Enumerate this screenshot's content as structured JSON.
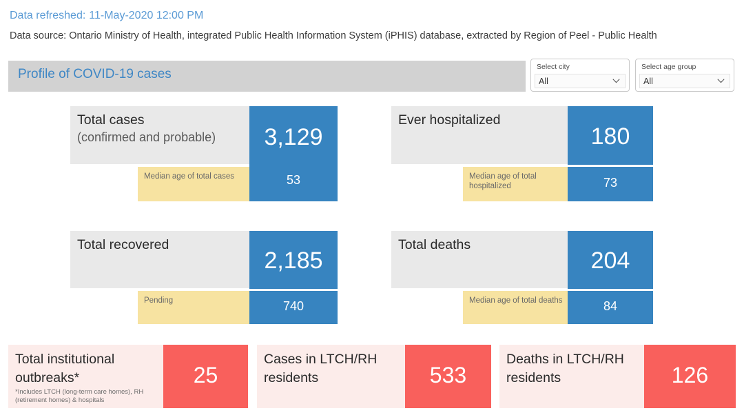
{
  "header": {
    "refresh_label": "Data refreshed:",
    "refresh_value": "11-May-2020 12:00 PM",
    "source_line": "Data source: Ontario Ministry of Health, integrated Public Health Information System (iPHIS) database, extracted by Region of Peel - Public Health",
    "title": "Profile of COVID-19 cases"
  },
  "slicers": [
    {
      "label": "Select city",
      "value": "All"
    },
    {
      "label": "Select age group",
      "value": "All"
    }
  ],
  "kpi_cards": [
    {
      "title": "Total cases",
      "subtitle": "(confirmed and probable)",
      "value": "3,129",
      "secondary_label": "Median age of total cases",
      "secondary_value": "53"
    },
    {
      "title": "Ever hospitalized",
      "subtitle": "",
      "value": "180",
      "secondary_label": "Median age of total hospitalized",
      "secondary_value": "73"
    },
    {
      "title": "Total recovered",
      "subtitle": "",
      "value": "2,185",
      "secondary_label": "Pending",
      "secondary_value": "740"
    },
    {
      "title": "Total deaths",
      "subtitle": "",
      "value": "204",
      "secondary_label": "Median age of total deaths",
      "secondary_value": "84"
    }
  ],
  "outbreak_cards": [
    {
      "title": "Total institutional outbreaks*",
      "note": "*Includes LTCH (long-term care homes), RH (retirement homes) & hospitals",
      "value": "25"
    },
    {
      "title": "Cases in LTCH/RH residents",
      "note": "",
      "value": "533"
    },
    {
      "title": "Deaths in LTCH/RH residents",
      "note": "",
      "value": "126"
    }
  ],
  "colors": {
    "accent_blue": "#3784c0",
    "title_blue": "#4a8fcb",
    "gray_panel": "#e9e9e9",
    "yellow_panel": "#f7e3a1",
    "red_block": "#f9605c",
    "pink_panel": "#fcecea",
    "header_bar": "#d2d2d2"
  }
}
